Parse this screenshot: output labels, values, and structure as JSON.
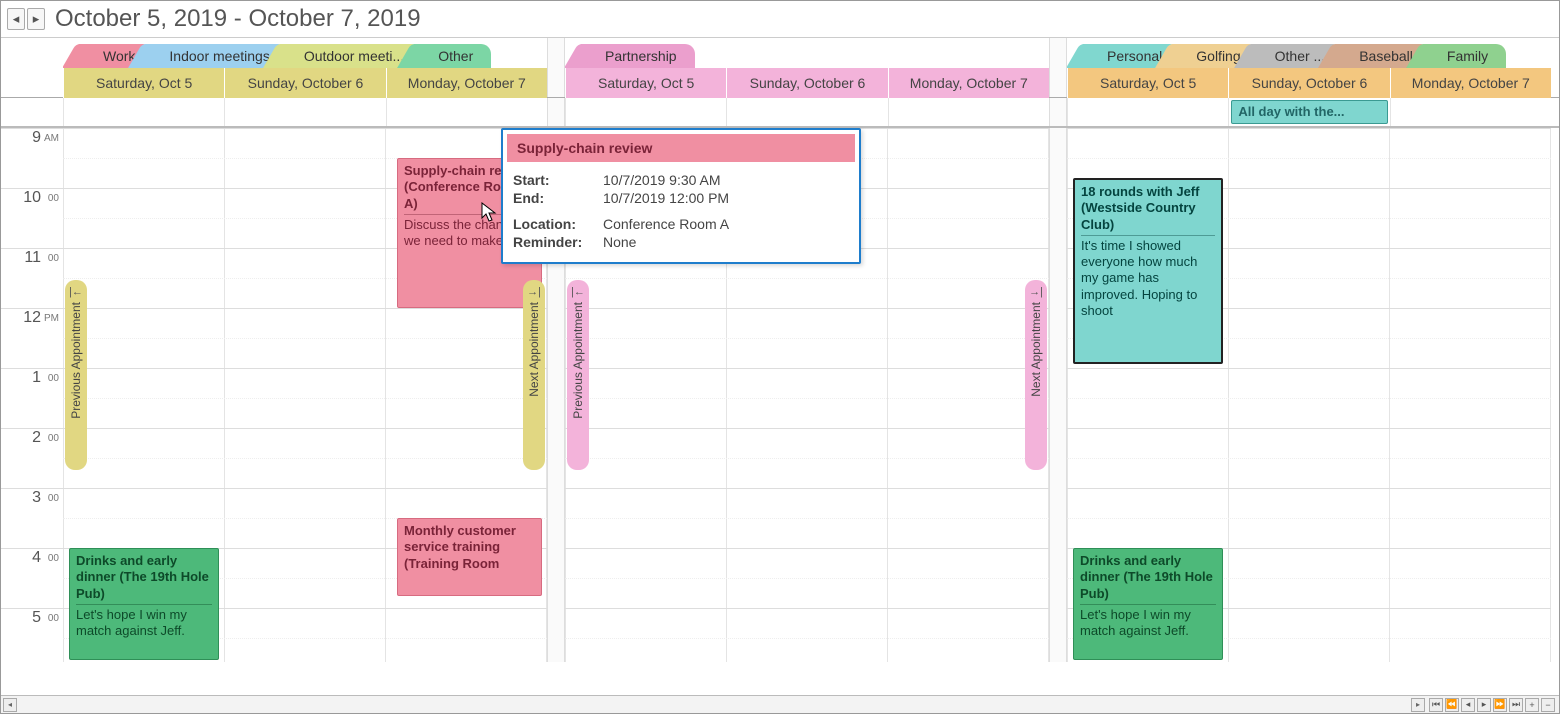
{
  "header": {
    "title": "October 5, 2019 - October 7, 2019"
  },
  "panels": [
    {
      "tabs": [
        {
          "label": "Work",
          "style": "work"
        },
        {
          "label": "Indoor meetings",
          "style": "indoor"
        },
        {
          "label": "Outdoor meeti...",
          "style": "outdoor"
        },
        {
          "label": "Other",
          "style": "other"
        }
      ],
      "dates": [
        "Saturday, Oct 5",
        "Sunday, October 6",
        "Monday, October 7"
      ],
      "prev_marker": "Previous Appointment",
      "next_marker": "Next Appointment"
    },
    {
      "tabs": [
        {
          "label": "Partnership",
          "style": "partner"
        }
      ],
      "dates": [
        "Saturday, Oct 5",
        "Sunday, October 6",
        "Monday, October 7"
      ],
      "prev_marker": "Previous Appointment",
      "next_marker": "Next Appointment"
    },
    {
      "tabs": [
        {
          "label": "Personal",
          "style": "personal"
        },
        {
          "label": "Golfing",
          "style": "golfing"
        },
        {
          "label": "Other ...",
          "style": "other2"
        },
        {
          "label": "Baseball",
          "style": "baseball"
        },
        {
          "label": "Family",
          "style": "family"
        }
      ],
      "dates": [
        "Saturday, Oct 5",
        "Sunday, October 6",
        "Monday, October 7"
      ],
      "allday": {
        "day": 1,
        "label": "All day with the..."
      }
    }
  ],
  "time_slots": [
    {
      "h": "9",
      "ampm": "AM"
    },
    {
      "h": "10",
      "ampm": "00"
    },
    {
      "h": "11",
      "ampm": "00"
    },
    {
      "h": "12",
      "ampm": "PM"
    },
    {
      "h": "1",
      "ampm": "00"
    },
    {
      "h": "2",
      "ampm": "00"
    },
    {
      "h": "3",
      "ampm": "00"
    },
    {
      "h": "4",
      "ampm": "00"
    },
    {
      "h": "5",
      "ampm": "00"
    }
  ],
  "events": {
    "supply_chain": {
      "title": "Supply-chain review (Conference Room A)",
      "desc": "Discuss the changes we need to make to"
    },
    "monthly_cs": {
      "title": "Monthly customer service training (Training Room"
    },
    "drinks_p1": {
      "title": "Drinks and early dinner (The 19th Hole Pub)",
      "desc": "Let's hope I win my match against Jeff."
    },
    "drinks_p3": {
      "title": "Drinks and early dinner (The 19th Hole Pub)",
      "desc": "Let's hope I win my match against Jeff."
    },
    "golf_18": {
      "title": "18 rounds with Jeff (Westside Country Club)",
      "desc": "It's time I showed everyone how much my game has improved. Hoping to shoot"
    }
  },
  "tooltip": {
    "title": "Supply-chain review",
    "start_k": "Start:",
    "start_v": "10/7/2019 9:30 AM",
    "end_k": "End:",
    "end_v": "10/7/2019 12:00 PM",
    "loc_k": "Location:",
    "loc_v": "Conference Room A",
    "rem_k": "Reminder:",
    "rem_v": "None"
  }
}
